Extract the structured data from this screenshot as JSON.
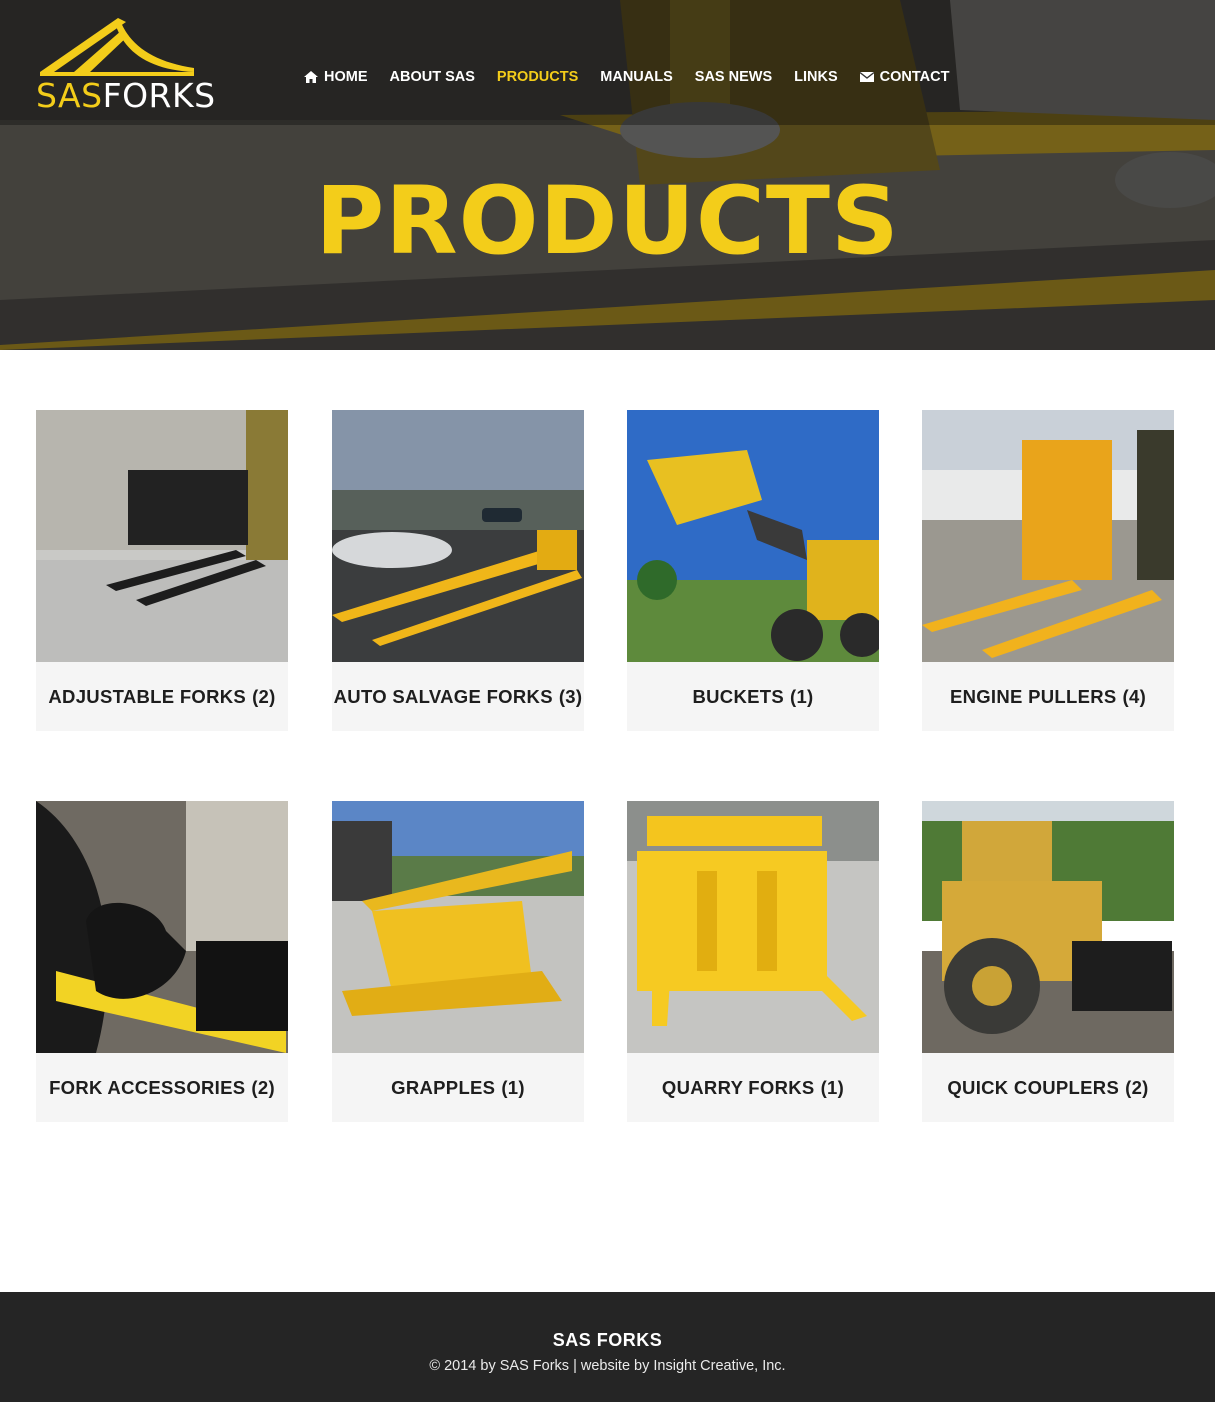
{
  "brand": {
    "logo_part1": "SAS",
    "logo_part2": "FORKS",
    "accent_color": "#f3cd1a"
  },
  "nav": {
    "items": [
      {
        "label": "HOME",
        "icon": "home-icon",
        "active": false
      },
      {
        "label": "ABOUT SAS",
        "active": false
      },
      {
        "label": "PRODUCTS",
        "active": true
      },
      {
        "label": "MANUALS",
        "active": false
      },
      {
        "label": "SAS NEWS",
        "active": false
      },
      {
        "label": "LINKS",
        "active": false
      },
      {
        "label": "CONTACT",
        "icon": "envelope-icon",
        "active": false
      }
    ]
  },
  "hero": {
    "title": "PRODUCTS"
  },
  "products": [
    {
      "name": "ADJUSTABLE FORKS",
      "count": "(2)"
    },
    {
      "name": "AUTO SALVAGE FORKS",
      "count": "(3)"
    },
    {
      "name": "BUCKETS",
      "count": "(1)"
    },
    {
      "name": "ENGINE PULLERS",
      "count": "(4)"
    },
    {
      "name": "FORK ACCESSORIES",
      "count": "(2)"
    },
    {
      "name": "GRAPPLES",
      "count": "(1)"
    },
    {
      "name": "QUARRY FORKS",
      "count": "(1)"
    },
    {
      "name": "QUICK COUPLERS",
      "count": "(2)"
    }
  ],
  "footer": {
    "title": "SAS FORKS",
    "copyright": "© 2014 by SAS Forks | website by Insight Creative, Inc."
  }
}
